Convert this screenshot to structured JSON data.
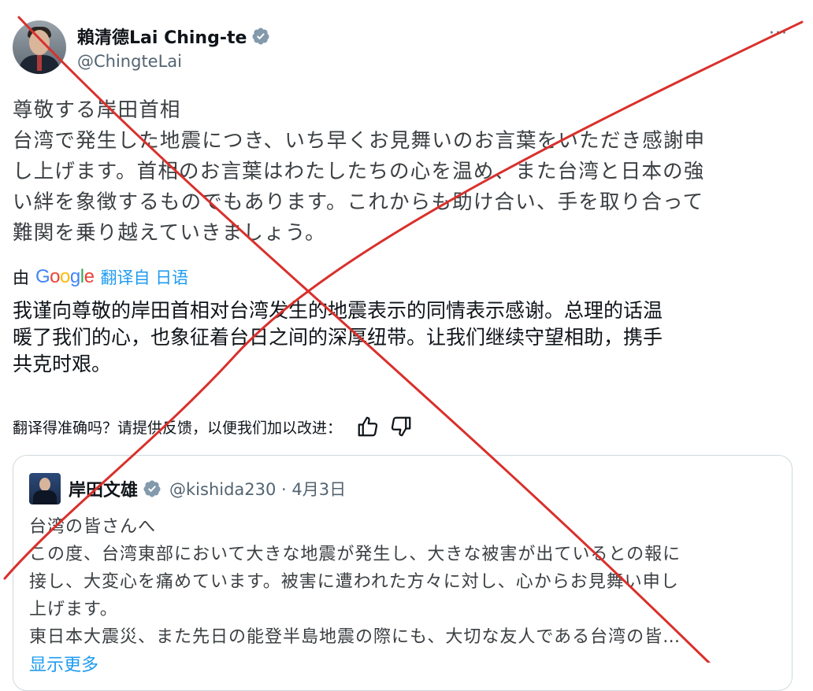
{
  "author": {
    "name": "賴清德Lai Ching-te",
    "handle": "@ChingteLai",
    "more_label": "···"
  },
  "tweet": {
    "lines": [
      "尊敬する岸田首相",
      "台湾で発生した地震につき、いち早くお見舞いのお言葉をいただき感謝申",
      "し上げます。首相のお言葉はわたしたちの心を温め、また台湾と日本の強",
      "い絆を象徴するものでもあります。これからも助け合い、手を取り合って",
      "難関を乗り越えていきましょう。"
    ]
  },
  "translation": {
    "by_label": "由",
    "google_letters": [
      "G",
      "o",
      "o",
      "g",
      "l",
      "e"
    ],
    "source_label": "翻译自 日语",
    "lines": [
      "我谨向尊敬的岸田首相对台湾发生的地震表示的同情表示感谢。总理的话温",
      "暖了我们的心，也象征着台日之间的深厚纽带。让我们继续守望相助，携手",
      "共克时艰。"
    ],
    "feedback_prompt": "翻译得准确吗？请提供反馈，以便我们加以改进："
  },
  "quoted_tweet": {
    "name": "岸田文雄",
    "handle_date": "@kishida230 · 4月3日",
    "lines": [
      "台湾の皆さんへ",
      "この度、台湾東部において大きな地震が発生し、大きな被害が出ているとの報に",
      "接し、大変心を痛めています。被害に遭われた方々に対し、心からお見舞い申し",
      "上げます。",
      "東日本大震災、また先日の能登半島地震の際にも、大切な友人である台湾の皆…"
    ],
    "show_more": "显示更多"
  },
  "colors": {
    "verified_badge": "#829aab",
    "link": "#1d9bf0",
    "overlay_cross": "#d9302c"
  },
  "icons": {
    "verified": "verified-badge-icon",
    "thumbs_up": "thumbs-up-icon",
    "thumbs_down": "thumbs-down-icon",
    "more": "more-horizontal-icon"
  }
}
